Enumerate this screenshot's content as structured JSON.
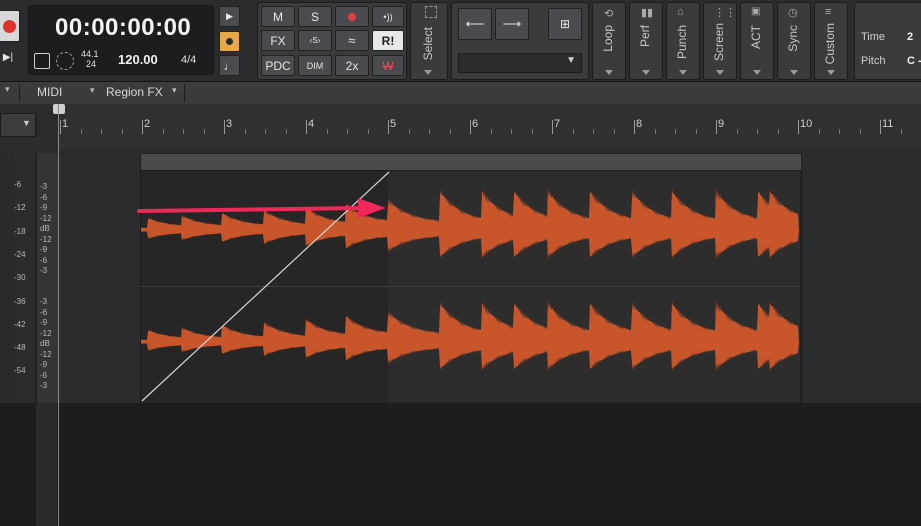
{
  "transport": {
    "time": "00:00:00:00",
    "sample_rate": "44.1",
    "bit_depth": "24",
    "tempo": "120.00",
    "meter": "4/4"
  },
  "mix_buttons": {
    "m": "M",
    "s": "S",
    "fx": "FX",
    "pdc": "PDC",
    "dim": "DIM",
    "two_x": "2x",
    "r": "R!",
    "w": "W"
  },
  "modules": {
    "select": "Select",
    "loop": "Loop",
    "perf": "Perf",
    "punch": "Punch",
    "screen": "Screen",
    "act": "ACT",
    "sync": "Sync",
    "custom": "Custom"
  },
  "info": {
    "time_label": "Time",
    "time_value": "2",
    "pitch_label": "Pitch",
    "pitch_value": "C -"
  },
  "menubar": {
    "midi": "MIDI",
    "region_fx": "Region FX"
  },
  "ruler_ticks": [
    "1",
    "2",
    "3",
    "4",
    "5",
    "6",
    "7",
    "8",
    "9",
    "10",
    "11"
  ],
  "db_scale_left": [
    "-6",
    "-12",
    "-18",
    "-24",
    "-30",
    "-36",
    "-42",
    "-48",
    "-54"
  ],
  "db_scale_meter_top": [
    "-3",
    "-6",
    "-9",
    "-12",
    "dB",
    "-12",
    "-9",
    "-6",
    "-3"
  ],
  "db_scale_meter_bottom": [
    "-3",
    "-6",
    "-9",
    "-12",
    "dB",
    "-12",
    "-9",
    "-6",
    "-3"
  ],
  "colors": {
    "waveform": "#c9562a",
    "arrow": "#f0285a",
    "clip_bg": "#262626"
  }
}
